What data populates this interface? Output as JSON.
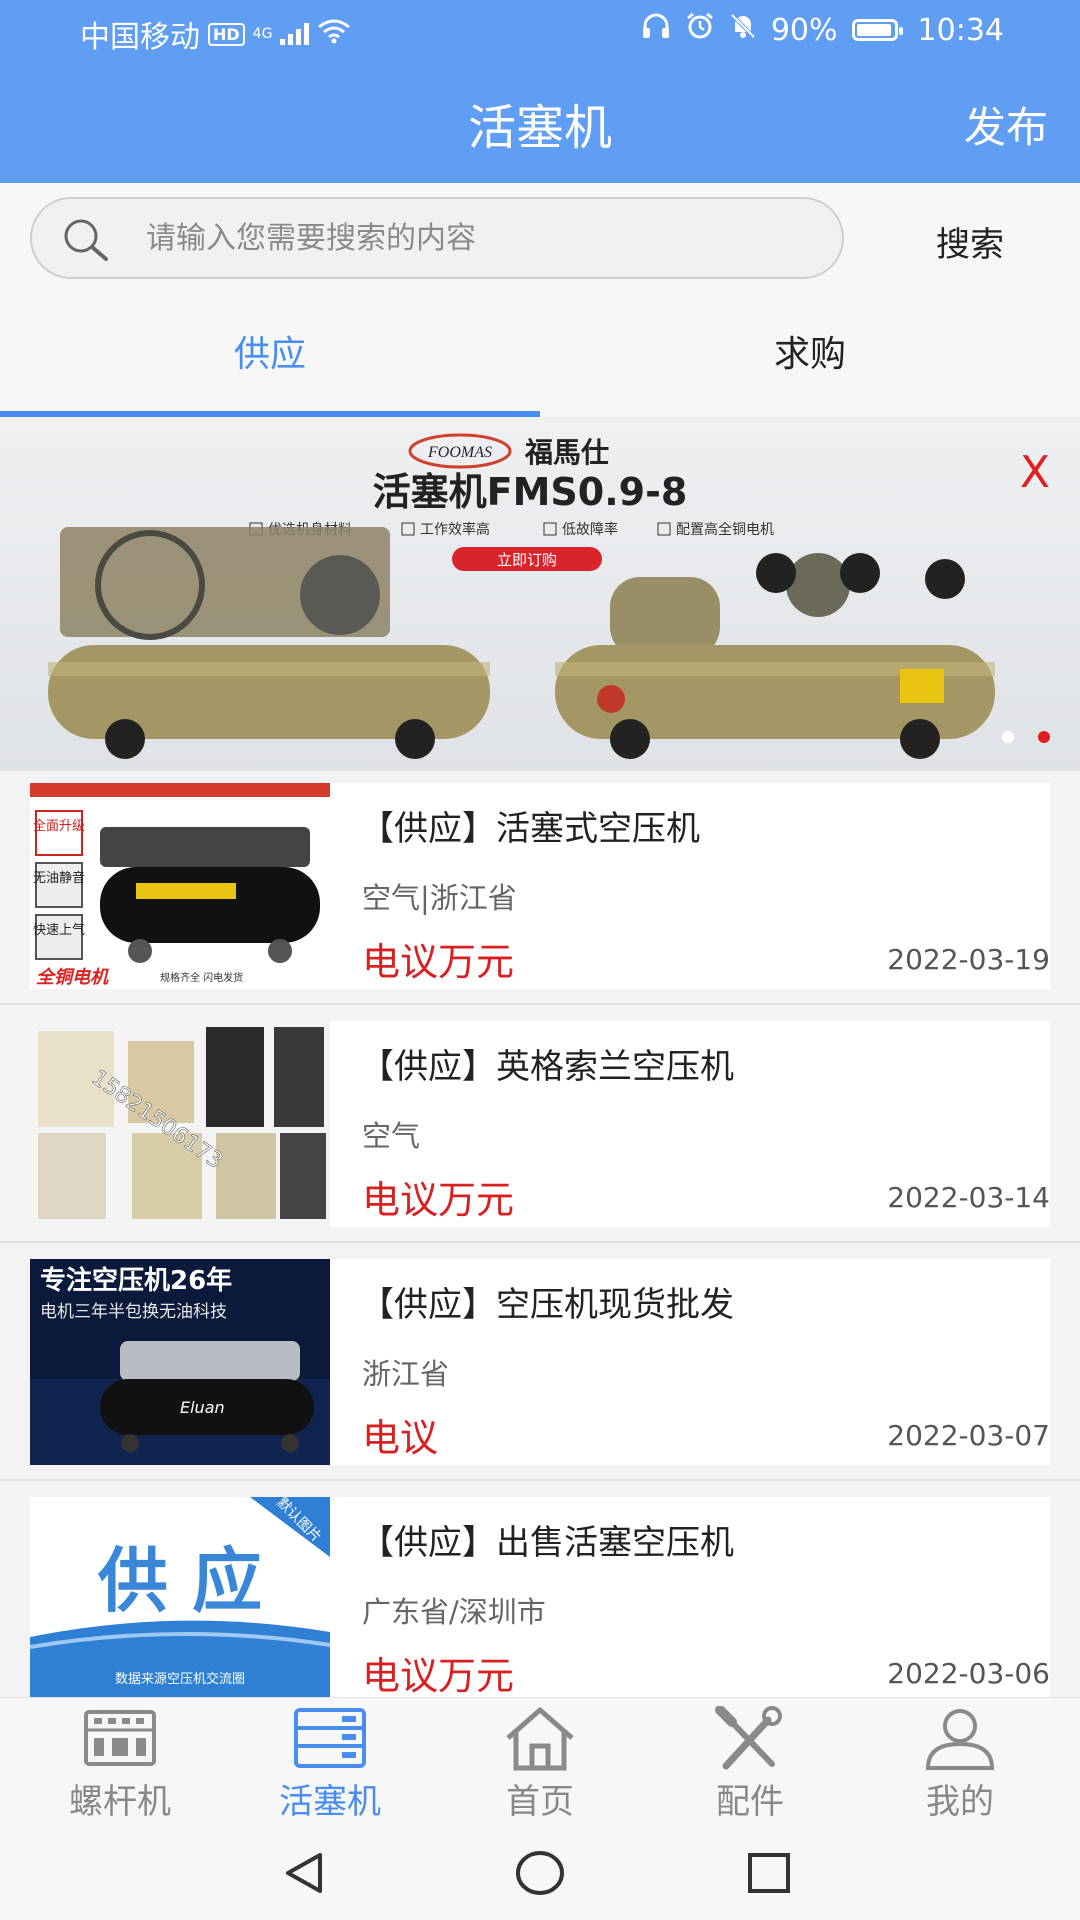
{
  "status_bar": {
    "carrier": "中国移动",
    "hd": "HD",
    "network": "4G",
    "battery_percent": "90%",
    "time": "10:34"
  },
  "header": {
    "title": "活塞机",
    "publish_label": "发布"
  },
  "search": {
    "placeholder": "请输入您需要搜索的内容",
    "button_label": "搜索"
  },
  "tabs": [
    {
      "label": "供应",
      "active": true
    },
    {
      "label": "求购",
      "active": false
    }
  ],
  "banner": {
    "brand_en": "FOOMAS",
    "brand_cn": "福馬仕",
    "headline": "活塞机FMS0.9-8",
    "features": [
      "优选机身材料",
      "工作效率高",
      "低故障率",
      "配置高全铜电机"
    ],
    "cta": "立即订购",
    "close": "X",
    "page_count": 2,
    "current_page": 2
  },
  "listings": [
    {
      "title": "【供应】活塞式空压机",
      "location": "空气|浙江省",
      "price": "电议万元",
      "date": "2022-03-19",
      "thumb_labels": [
        "全面升级",
        "无油静音",
        "快速上气",
        "全铜电机",
        "规格齐全 闪电发货"
      ]
    },
    {
      "title": "【供应】英格索兰空压机",
      "location": "空气",
      "price": "电议万元",
      "date": "2022-03-14",
      "thumb_watermark": "15821506173"
    },
    {
      "title": "【供应】空压机现货批发",
      "location": "浙江省",
      "price": "电议",
      "date": "2022-03-07",
      "thumb_labels": [
        "专注空压机26年",
        "电机三年半包换无油科技",
        "Eluan"
      ]
    },
    {
      "title": "【供应】出售活塞空压机",
      "location": "广东省/深圳市",
      "price": "电议万元",
      "date": "2022-03-06",
      "thumb_labels": [
        "供 应",
        "默认图片",
        "数据来源空压机交流圈"
      ]
    }
  ],
  "bottom_nav": [
    {
      "label": "螺杆机",
      "icon": "screw-compressor-icon",
      "active": false
    },
    {
      "label": "活塞机",
      "icon": "piston-compressor-icon",
      "active": true
    },
    {
      "label": "首页",
      "icon": "home-icon",
      "active": false
    },
    {
      "label": "配件",
      "icon": "tools-icon",
      "active": false
    },
    {
      "label": "我的",
      "icon": "user-icon",
      "active": false
    }
  ],
  "colors": {
    "header_blue": "#5f9ef3",
    "accent_blue": "#4a8df0",
    "price_red": "#d92020"
  }
}
